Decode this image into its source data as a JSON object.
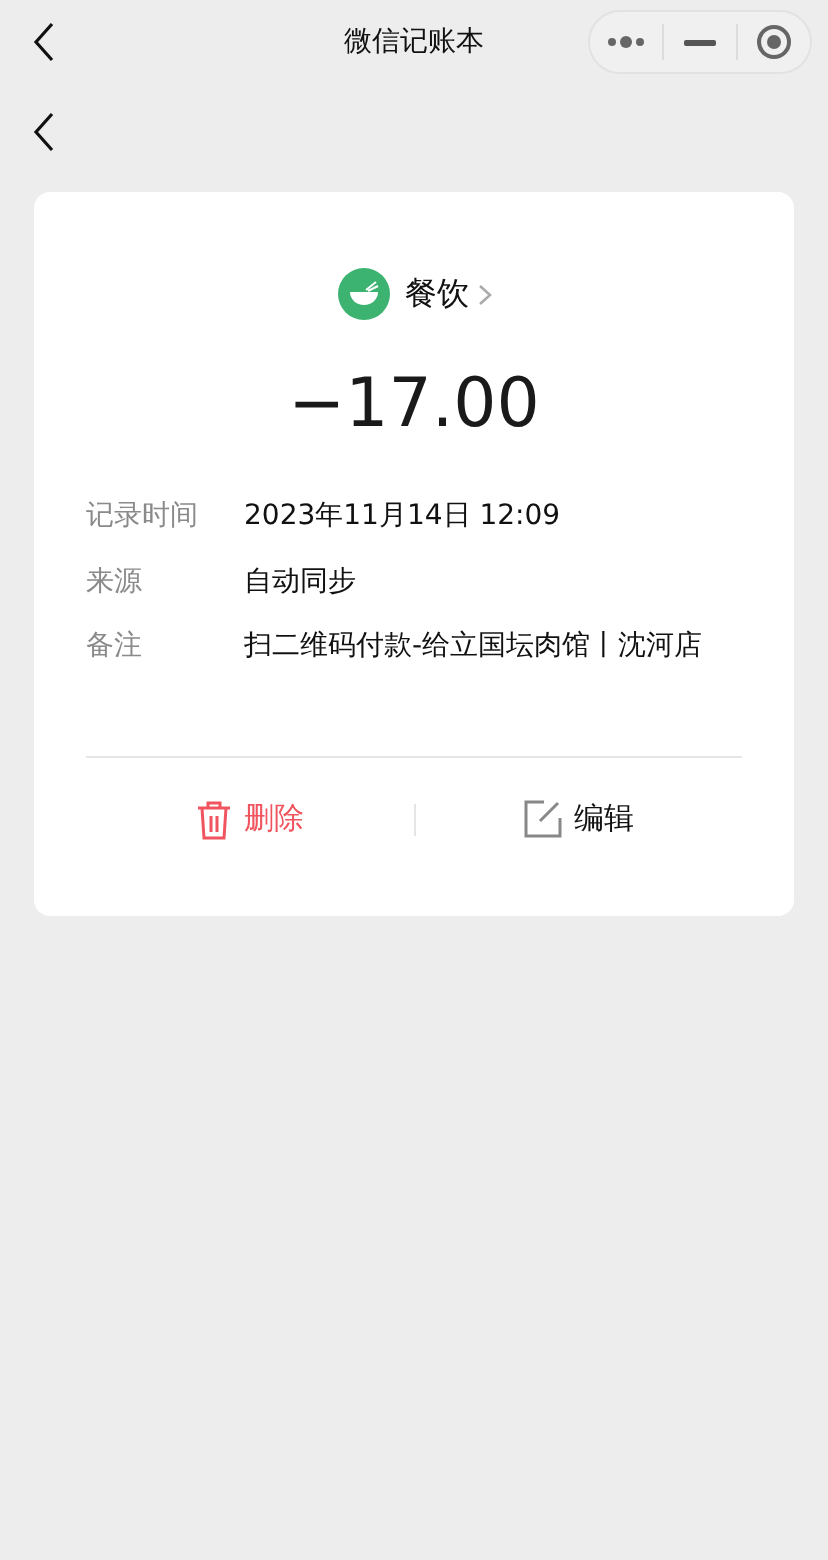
{
  "window": {
    "title": "微信记账本"
  },
  "category": {
    "name": "餐饮",
    "color": "#3cb371"
  },
  "amount": "−17.00",
  "details": [
    {
      "label": "记录时间",
      "value": "2023年11月14日 12:09"
    },
    {
      "label": "来源",
      "value": "自动同步"
    },
    {
      "label": "备注",
      "value": "扫二维码付款-给立国坛肉馆丨沈河店"
    }
  ],
  "actions": [
    {
      "kind": "delete",
      "label": "删除"
    },
    {
      "kind": "edit",
      "label": "编辑"
    }
  ]
}
